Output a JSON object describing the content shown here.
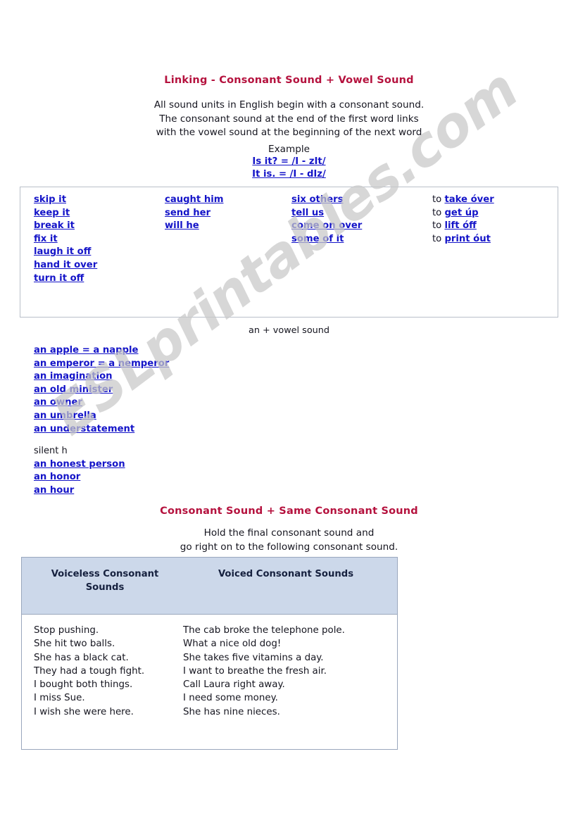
{
  "watermark": {
    "text": "ESLprintables.com"
  },
  "colors": {
    "heading": "#b5123e",
    "link": "#1414c8",
    "table_header_bg": "#ccd8ea",
    "table_border": "#9aa7bd",
    "box_border": "#b9bfc9"
  },
  "section1": {
    "title": "Linking - Consonant Sound + Vowel Sound",
    "intro_lines": [
      "All sound units in English begin with a consonant sound.",
      "The consonant sound at the end of the first word links",
      "with the vowel sound at the beginning of the next word"
    ],
    "example_label": "Example",
    "example_lines": [
      "Is it? = /I - zIt/",
      "It is. = /I - dIz/"
    ],
    "columns": [
      {
        "items": [
          "skip it",
          "keep it",
          "break it",
          "fix it",
          "laugh it off",
          "hand it over",
          "turn it off"
        ]
      },
      {
        "items": [
          "caught him",
          "send her",
          "will he"
        ]
      },
      {
        "items": [
          "six others",
          "tell us",
          "come on over",
          "some of it"
        ]
      },
      {
        "prefix": "to ",
        "items": [
          "take óver",
          "get úp",
          "lift óff",
          "print óut"
        ]
      }
    ]
  },
  "section_an": {
    "label": "an + vowel sound",
    "items": [
      "an apple =  a napple",
      "an emperor = a nemperor",
      "an imagination",
      "an old minister",
      "an owner",
      "an umbrella",
      "an understatement"
    ],
    "silent_h_label": "silent h",
    "silent_h_items": [
      "an honest person",
      "an honor",
      "an hour"
    ]
  },
  "section2": {
    "title": "Consonant Sound + Same Consonant Sound",
    "intro_lines": [
      "Hold the final consonant sound and",
      "go right on to the following consonant sound."
    ],
    "table": {
      "headers": [
        "Voiceless Consonant Sounds",
        "Voiced Consonant Sounds"
      ],
      "column_voiceless": [
        "Stop pushing.",
        "She hit two balls.",
        "She has a black cat.",
        "They had a tough fight.",
        "I bought both things.",
        "I miss Sue.",
        "I wish she were here."
      ],
      "column_voiced": [
        "The cab broke the telephone pole.",
        "What a nice old dog!",
        "She takes five vitamins a day.",
        "I want to breathe the fresh air.",
        "Call Laura right away.",
        "I need some money.",
        "She has nine nieces."
      ]
    }
  }
}
